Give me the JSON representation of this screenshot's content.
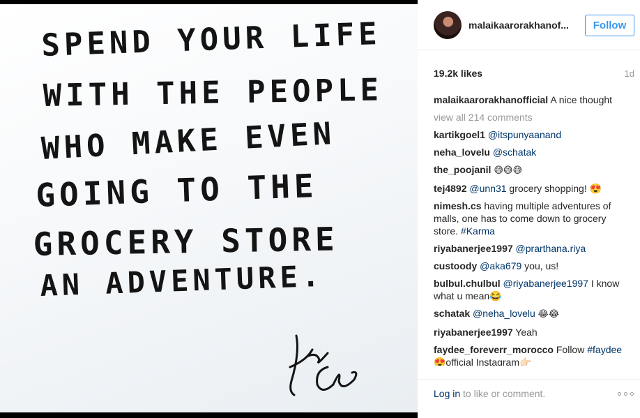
{
  "photo": {
    "lines": [
      "SPEND YOUR LIFE",
      "WITH THE PEOPLE",
      "WHO MAKE EVEN",
      "GOING TO THE",
      "GROCERY STORE",
      "AN ADVENTURE."
    ],
    "signature": "Love Cleo"
  },
  "post": {
    "username": "malaikaarorakhanof...",
    "follow_label": "Follow",
    "likes": "19.2k likes",
    "age": "1d",
    "caption_user": "malaikaarorakhanofficial",
    "caption_text": "A nice thought",
    "view_all": "view all 214 comments"
  },
  "comments": [
    {
      "user": "kartikgoel1",
      "mention": "@itspunyaanand",
      "text": ""
    },
    {
      "user": "neha_lovelu",
      "mention": "@schatak",
      "text": ""
    },
    {
      "user": "the_poojanil",
      "mention": "",
      "text": "😅😅😅"
    },
    {
      "user": "tej4892",
      "mention": "@unn31",
      "text": "grocery shopping! 😍"
    },
    {
      "user": "nimesh.cs",
      "mention": "",
      "text": "having multiple adventures of malls, one has to come down to grocery store.",
      "tag": "#Karma"
    },
    {
      "user": "riyabanerjee1997",
      "mention": "@prarthana.riya",
      "text": ""
    },
    {
      "user": "custoody",
      "mention": "@aka679",
      "text": "you, us!"
    },
    {
      "user": "bulbul.chulbul",
      "mention": "@riyabanerjee1997",
      "text": "I know what u mean😂"
    },
    {
      "user": "schatak",
      "mention": "@neha_lovelu",
      "text": "😂😂"
    },
    {
      "user": "riyabanerjee1997",
      "mention": "",
      "text": "Yeah"
    },
    {
      "user": "faydee_foreverr_morocco",
      "mention": "",
      "text": "Follow",
      "tag": "#faydee",
      "text2": "😍official Instagram👉🏻"
    }
  ],
  "footer": {
    "login_link": "Log in",
    "login_rest": "to like or comment."
  },
  "colors": {
    "follow_blue": "#3897f0",
    "link_blue": "#003569",
    "muted": "#999999"
  },
  "icons": {
    "more": "ellipsis-icon"
  }
}
